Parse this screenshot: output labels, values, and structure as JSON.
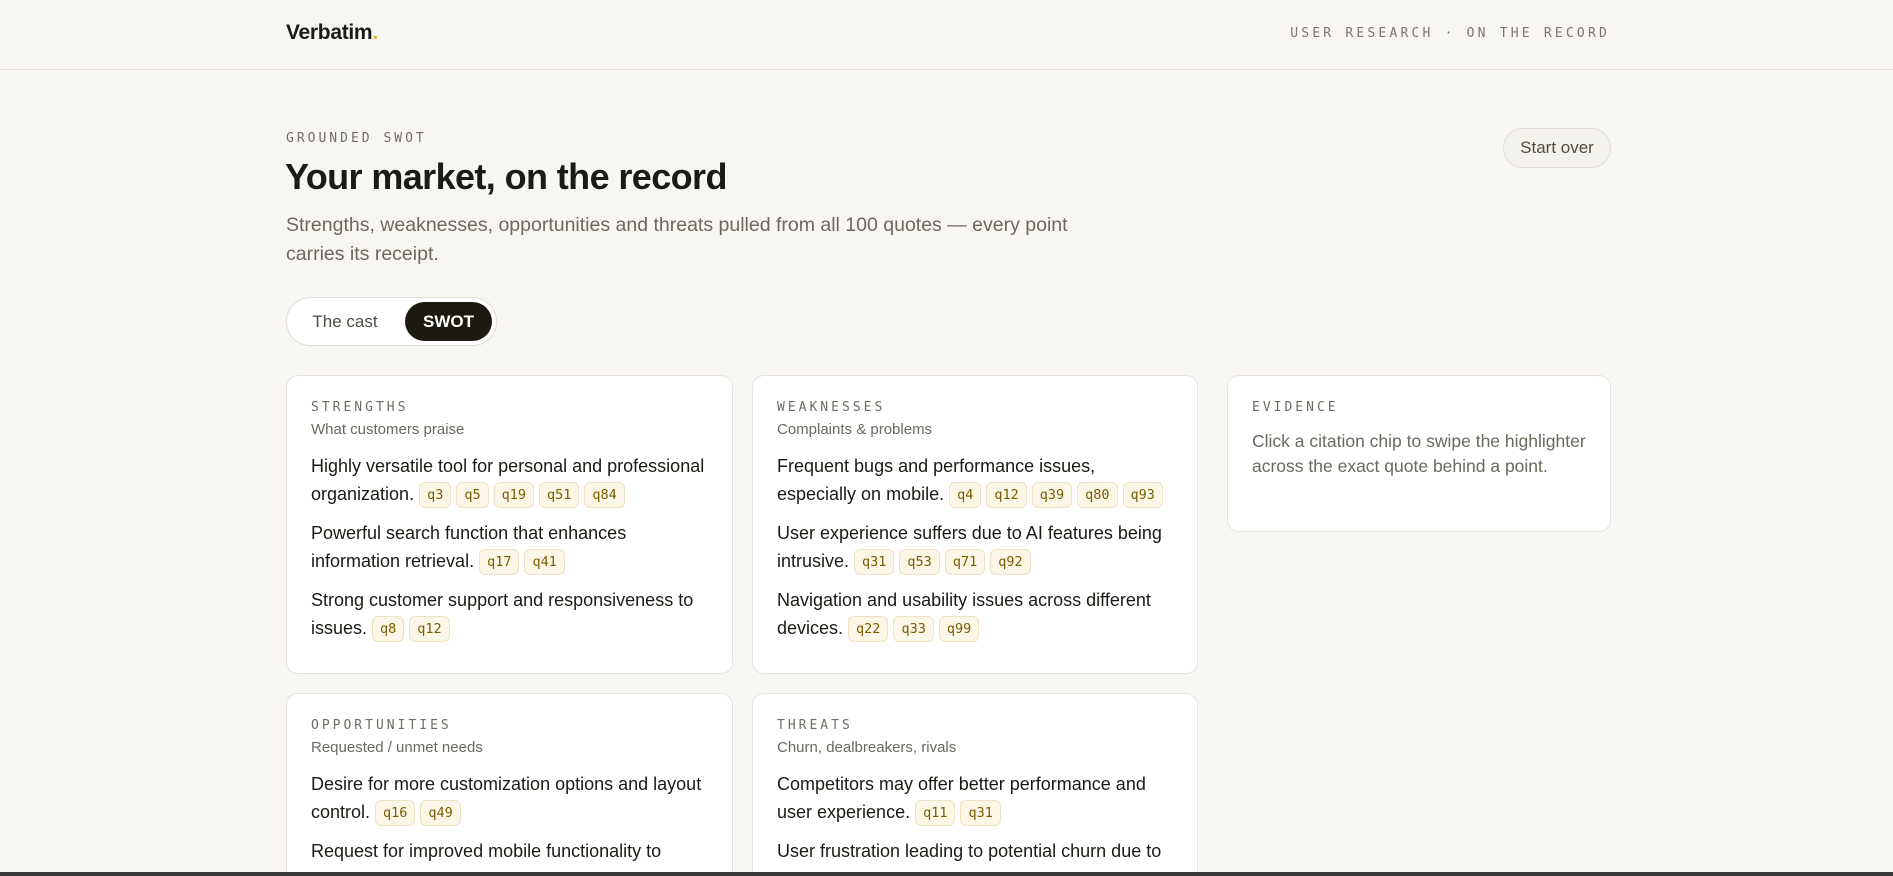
{
  "header": {
    "brand": "Verbatim",
    "brand_dot": ".",
    "tagline": "USER RESEARCH · ON THE RECORD"
  },
  "hero": {
    "eyebrow": "GROUNDED SWOT",
    "title": "Your market, on the record",
    "subtitle": "Strengths, weaknesses, opportunities and threats pulled from all 100 quotes — every point carries its receipt.",
    "start_over": "Start over"
  },
  "toggle": {
    "cast_label": "The cast",
    "swot_label": "SWOT",
    "selected": "SWOT"
  },
  "colors": {
    "background": "#f7f6f2",
    "accent_dark": "#1c1a10",
    "chip_text": "#7a5c00",
    "chip_bg": "#fbf6e6",
    "brand_dot": "#d9b93a"
  },
  "swot": {
    "strengths": {
      "label": "STRENGTHS",
      "sub": "What customers praise",
      "points": [
        {
          "text": "Highly versatile tool for personal and professional organization.",
          "cites": [
            "q3",
            "q5",
            "q19",
            "q51",
            "q84"
          ]
        },
        {
          "text": "Powerful search function that enhances information retrieval.",
          "cites": [
            "q17",
            "q41"
          ]
        },
        {
          "text": "Strong customer support and responsiveness to issues.",
          "cites": [
            "q8",
            "q12"
          ]
        }
      ]
    },
    "weaknesses": {
      "label": "WEAKNESSES",
      "sub": "Complaints & problems",
      "points": [
        {
          "text": "Frequent bugs and performance issues, especially on mobile.",
          "cites": [
            "q4",
            "q12",
            "q39",
            "q80",
            "q93"
          ]
        },
        {
          "text": "User experience suffers due to AI features being intrusive.",
          "cites": [
            "q31",
            "q53",
            "q71",
            "q92"
          ]
        },
        {
          "text": "Navigation and usability issues across different devices.",
          "cites": [
            "q22",
            "q33",
            "q99"
          ]
        }
      ]
    },
    "opportunities": {
      "label": "OPPORTUNITIES",
      "sub": "Requested / unmet needs",
      "points": [
        {
          "text": "Desire for more customization options and layout control.",
          "cites": [
            "q16",
            "q49"
          ]
        },
        {
          "text": "Request for improved mobile functionality to",
          "cites": []
        }
      ]
    },
    "threats": {
      "label": "THREATS",
      "sub": "Churn, dealbreakers, rivals",
      "points": [
        {
          "text": "Competitors may offer better performance and user experience.",
          "cites": [
            "q11",
            "q31"
          ]
        },
        {
          "text": "User frustration leading to potential churn due to",
          "cites": []
        }
      ]
    }
  },
  "evidence": {
    "label": "EVIDENCE",
    "text": "Click a citation chip to swipe the highlighter across the exact quote behind a point."
  }
}
